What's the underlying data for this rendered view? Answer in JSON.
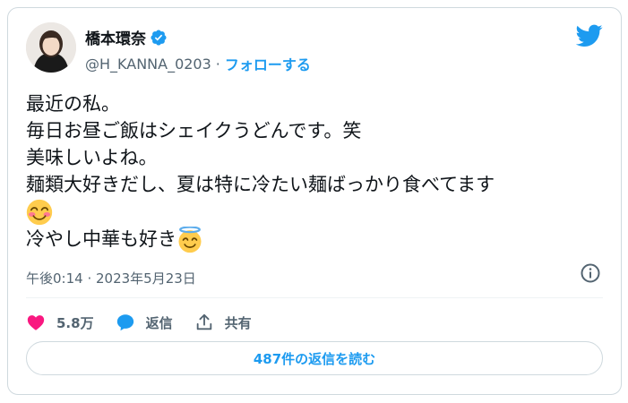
{
  "user": {
    "display_name": "橋本環奈",
    "handle": "@H_KANNA_0203",
    "separator": "·",
    "follow_label": "フォローする",
    "verified_icon": "verified-badge-icon"
  },
  "tweet": {
    "lines": [
      "最近の私。",
      "毎日お昼ご飯はシェイクうどんです。笑",
      "美味しいよね。",
      "麺類大好きだし、夏は特に冷たい麺ばっかり食べてます",
      "冷やし中華も好き"
    ],
    "emojis": [
      "smiling-face-with-smiling-eyes",
      "smiling-face-with-halo"
    ],
    "timestamp": "午後0:14 · 2023年5月23日"
  },
  "actions": {
    "like_count": "5.8万",
    "reply_label": "返信",
    "share_label": "共有"
  },
  "read_replies_label": "487件の返信を読む",
  "colors": {
    "accent": "#1d9bf0",
    "like": "#f91880",
    "text": "#0f1419",
    "muted": "#536471",
    "border": "#cfd9de"
  }
}
